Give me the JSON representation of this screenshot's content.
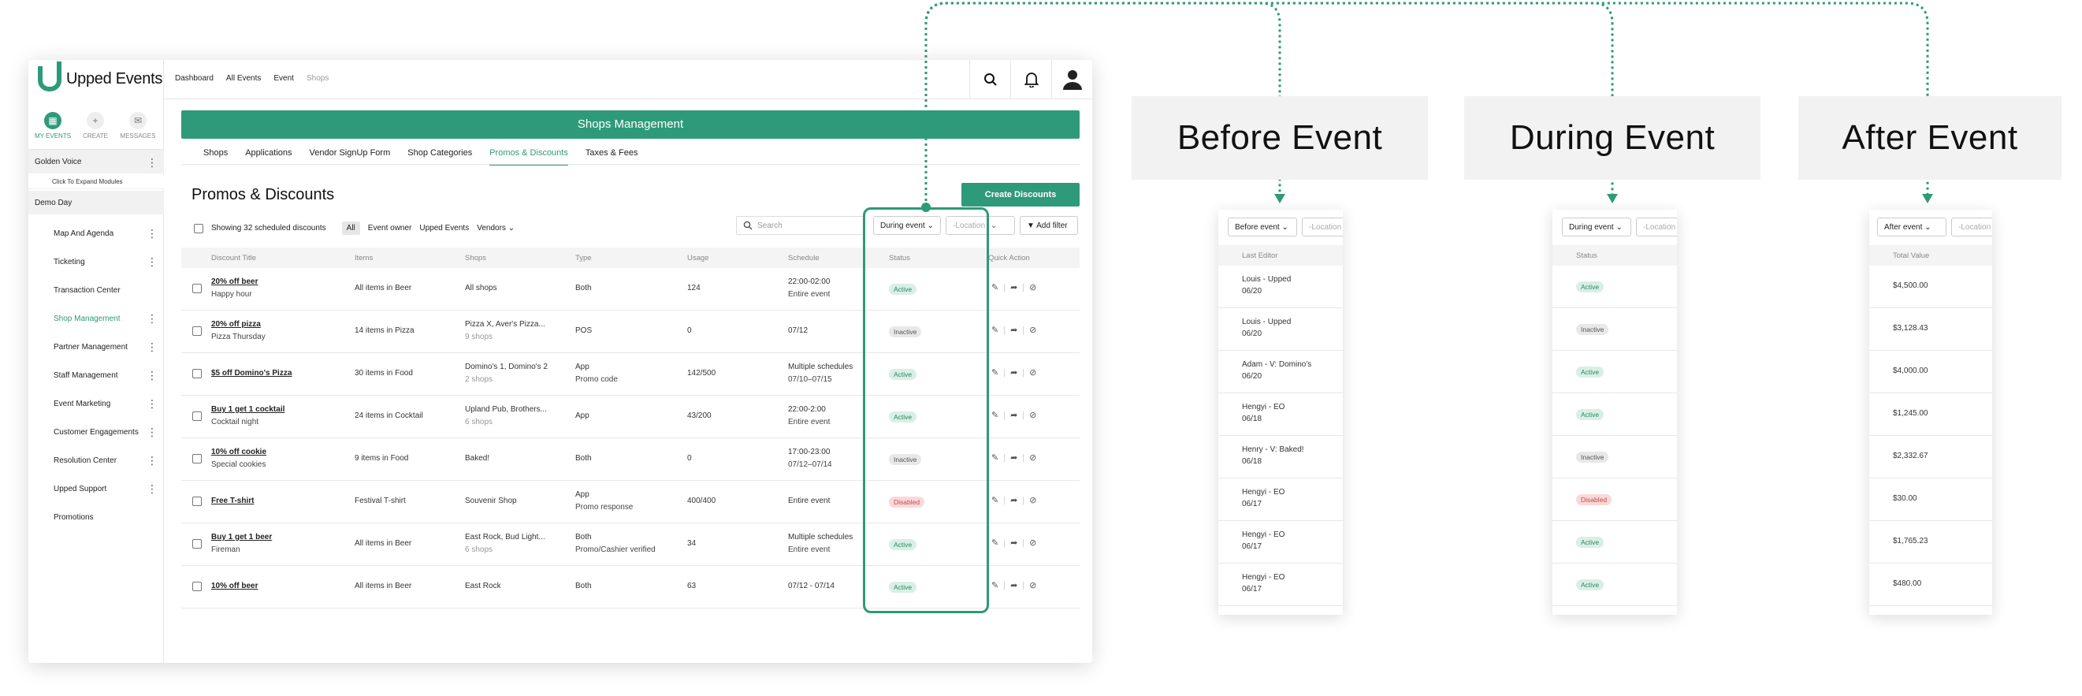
{
  "brand": {
    "name": "Upped Events",
    "accent": "#2e9a79"
  },
  "sidebar": {
    "tabs": [
      {
        "label": "MY EVENTS",
        "icon": "calendar-icon"
      },
      {
        "label": "CREATE",
        "icon": "plus-icon"
      },
      {
        "label": "MESSAGES",
        "icon": "mail-icon"
      }
    ],
    "org": "Golden Voice",
    "expand": "Click To Expand Modules",
    "event": "Demo Day",
    "items": [
      "Map And Agenda",
      "Ticketing",
      "Transaction Center",
      "Shop Management",
      "Partner Management",
      "Staff Management",
      "Event Marketing",
      "Customer Engagements",
      "Resolution Center",
      "Upped Support",
      "Promotions"
    ]
  },
  "breadcrumbs": [
    "Dashboard",
    "All Events",
    "Event",
    "Shops"
  ],
  "banner": "Shops Management",
  "tabs": [
    "Shops",
    "Applications",
    "Vendor SignUp Form",
    "Shop Categories",
    "Promos & Discounts",
    "Taxes & Fees"
  ],
  "page": {
    "title": "Promos & Discounts",
    "create": "Create Discounts"
  },
  "filters": {
    "count_text": "Showing 32 scheduled discounts",
    "chips": [
      "All",
      "Event owner",
      "Upped Events",
      "Vendors"
    ],
    "search_placeholder": "Search",
    "event_filter": "During event",
    "location": "-Location",
    "add_filter": "Add filter"
  },
  "columns": [
    "Discount Title",
    "Items",
    "Shops",
    "Type",
    "Usage",
    "Schedule",
    "Status",
    "Quick Action"
  ],
  "rows": [
    {
      "title": "20% off beer",
      "sub": "Happy hour",
      "items": "All items in Beer",
      "shops": "All shops",
      "shops_sub": "",
      "type": "Both",
      "type_sub": "",
      "usage": "124",
      "sched": "22:00-02:00",
      "sched_sub": "Entire event",
      "status": "Active"
    },
    {
      "title": "20% off pizza",
      "sub": "Pizza Thursday",
      "items": "14 items in Pizza",
      "shops": "Pizza X, Aver's Pizza...",
      "shops_sub": "9 shops",
      "type": "POS",
      "type_sub": "",
      "usage": "0",
      "sched": "07/12",
      "sched_sub": "",
      "status": "Inactive"
    },
    {
      "title": "$5 off Domino's Pizza",
      "sub": "",
      "items": "30 items in Food",
      "shops": "Domino's 1, Domino's 2",
      "shops_sub": "2 shops",
      "type": "App",
      "type_sub": "Promo code",
      "usage": "142/500",
      "sched": "Multiple schedules",
      "sched_sub": "07/10–07/15",
      "status": "Active"
    },
    {
      "title": "Buy 1 get 1 cocktail",
      "sub": "Cocktail night",
      "items": "24 items in Cocktail",
      "shops": "Upland Pub, Brothers...",
      "shops_sub": "6 shops",
      "type": "App",
      "type_sub": "",
      "usage": "43/200",
      "sched": "22:00-2:00",
      "sched_sub": "Entire event",
      "status": "Active"
    },
    {
      "title": "10% off cookie",
      "sub": "Special cookies",
      "items": "9 items in Food",
      "shops": "Baked!",
      "shops_sub": "",
      "type": "Both",
      "type_sub": "",
      "usage": "0",
      "sched": "17:00-23:00",
      "sched_sub": "07/12–07/14",
      "status": "Inactive"
    },
    {
      "title": "Free T-shirt",
      "sub": "",
      "items": "Festival T-shirt",
      "shops": "Souvenir Shop",
      "shops_sub": "",
      "type": "App",
      "type_sub": "Promo response",
      "usage": "400/400",
      "sched": "Entire event",
      "sched_sub": "",
      "status": "Disabled"
    },
    {
      "title": "Buy 1 get 1 beer",
      "sub": "Fireman",
      "items": "All items in Beer",
      "shops": "East Rock, Bud Light...",
      "shops_sub": "6 shops",
      "type": "Both",
      "type_sub": "Promo/Cashier verified",
      "usage": "34",
      "sched": "Multiple schedules",
      "sched_sub": "Entire event",
      "status": "Active"
    },
    {
      "title": "10% off beer",
      "sub": "",
      "items": "All items in Beer",
      "shops": "East Rock",
      "shops_sub": "",
      "type": "Both",
      "type_sub": "",
      "usage": "63",
      "sched": "07/12 - 07/14",
      "sched_sub": "",
      "status": "Active"
    }
  ],
  "states": [
    {
      "heading": "Before Event",
      "filter": "Before event",
      "location": "-Location",
      "column": "Last Editor",
      "rows": [
        [
          "Louis - Upped",
          "06/20"
        ],
        [
          "Louis - Upped",
          "06/20"
        ],
        [
          "Adam - V: Domino's",
          "06/20"
        ],
        [
          "Hengyi - EO",
          "06/18"
        ],
        [
          "Henry - V: Baked!",
          "06/18"
        ],
        [
          "Hengyi - EO",
          "06/17"
        ],
        [
          "Hengyi - EO",
          "06/17"
        ],
        [
          "Hengyi - EO",
          "06/17"
        ]
      ]
    },
    {
      "heading": "During Event",
      "filter": "During event",
      "location": "-Location",
      "column": "Status",
      "rows": [
        "Active",
        "Inactive",
        "Active",
        "Active",
        "Inactive",
        "Disabled",
        "Active",
        "Active"
      ]
    },
    {
      "heading": "After Event",
      "filter": "After event",
      "location": "-Location",
      "column": "Total Value",
      "rows": [
        "$4,500.00",
        "$3,128.43",
        "$4,000.00",
        "$1,245.00",
        "$2,332.67",
        "$30.00",
        "$1,765.23",
        "$480.00"
      ]
    }
  ]
}
